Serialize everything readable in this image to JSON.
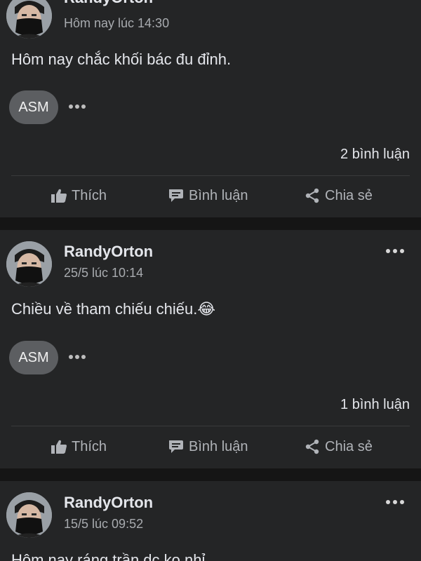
{
  "posts": [
    {
      "author": "RandyOrton",
      "time": "Hôm nay lúc 14:30",
      "content": "Hôm nay chắc khối bác đu đỉnh.",
      "tag": "ASM",
      "comments": "2 bình luận",
      "actions": {
        "like": "Thích",
        "comment": "Bình luận",
        "share": "Chia sẻ"
      }
    },
    {
      "author": "RandyOrton",
      "time": "25/5 lúc 10:14",
      "content": "Chiều về tham chiếu chiếu.😂",
      "tag": "ASM",
      "comments": "1 bình luận",
      "actions": {
        "like": "Thích",
        "comment": "Bình luận",
        "share": "Chia sẻ"
      }
    },
    {
      "author": "RandyOrton",
      "time": "15/5 lúc 09:52",
      "content": "Hôm nay ráng trần dc ko nhỉ",
      "tag": "",
      "comments": "",
      "actions": {
        "like": "",
        "comment": "",
        "share": ""
      }
    }
  ],
  "icons": {
    "like": "thumbs-up-icon",
    "comment": "comment-icon",
    "share": "share-icon",
    "more": "more-horizontal-icon"
  },
  "colors": {
    "background": "#151515",
    "card": "#242526",
    "tag": "#5c5e61",
    "muted_text": "#b0b3b8"
  }
}
